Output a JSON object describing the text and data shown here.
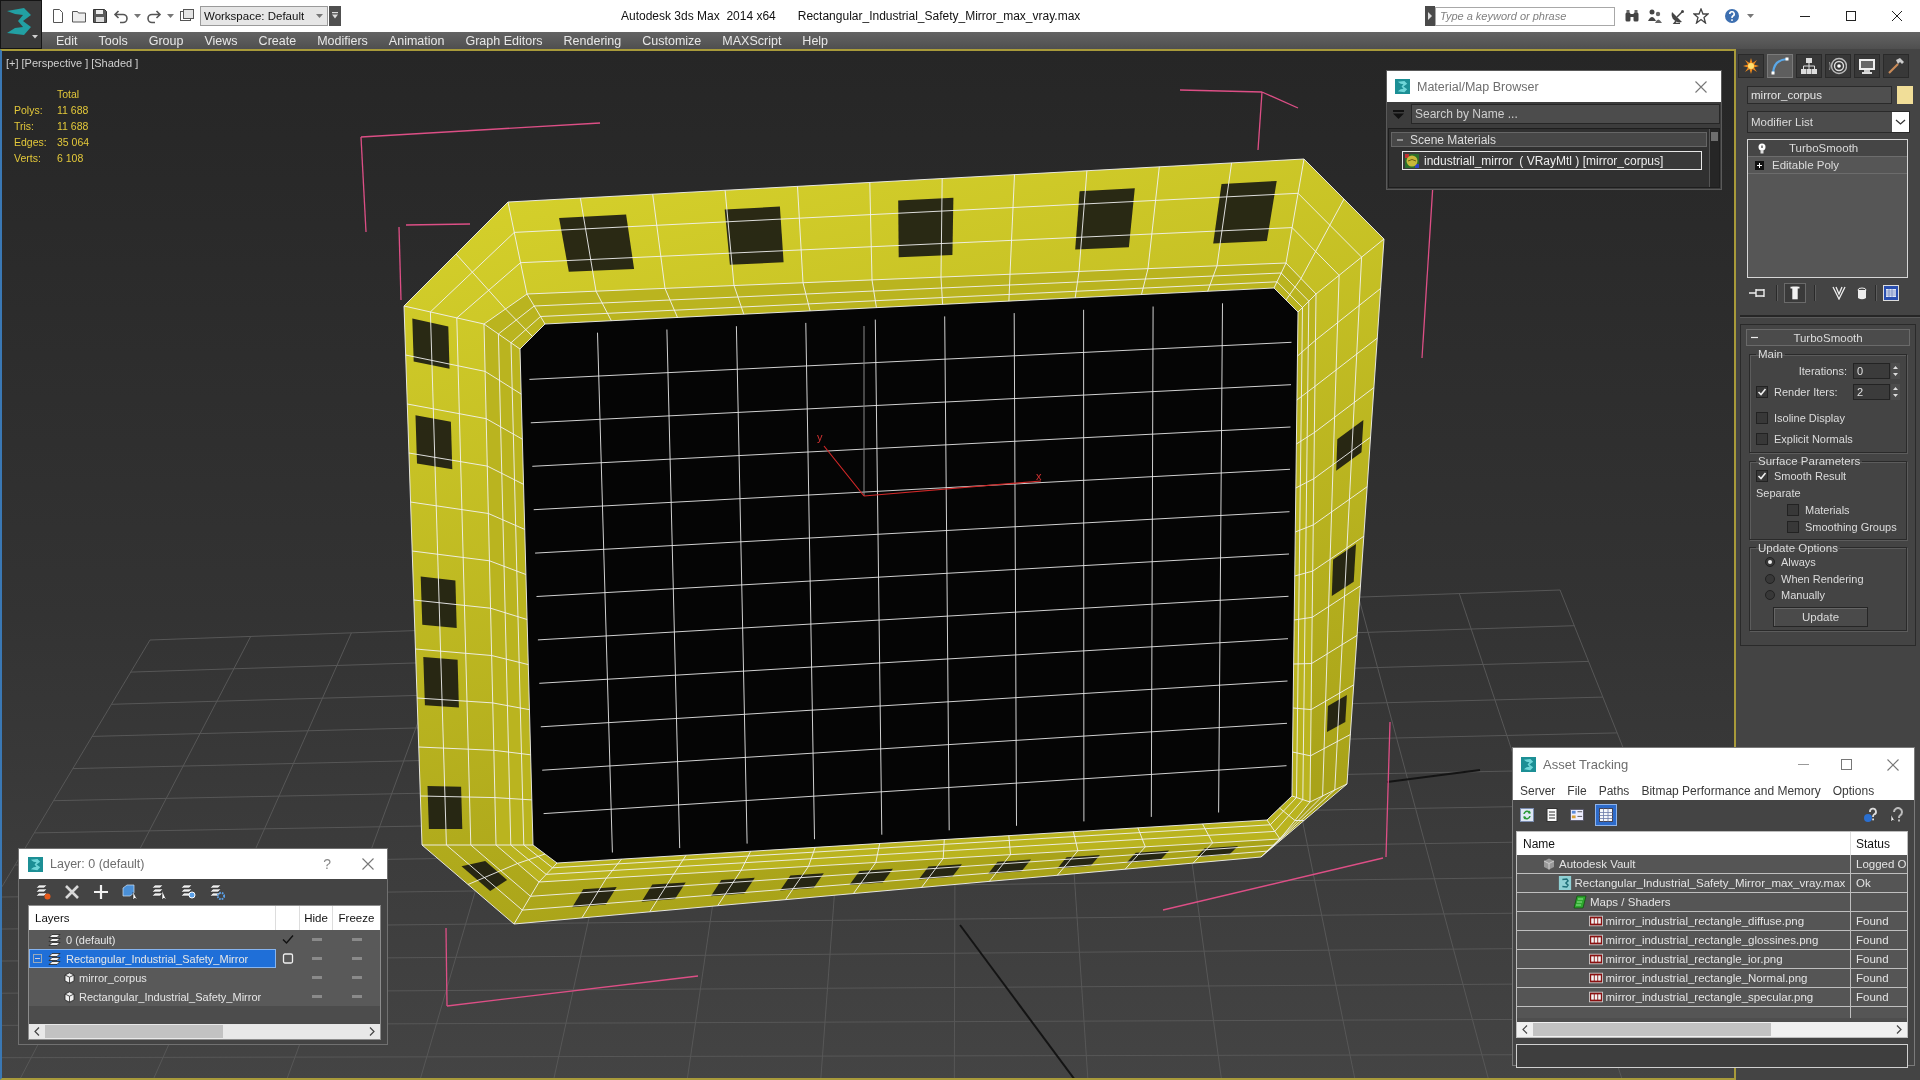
{
  "title_bar": {
    "workspace": "Workspace: Default",
    "app_title": "Autodesk 3ds Max  2014 x64",
    "file_name": "Rectangular_Industrial_Safety_Mirror_max_vray.max",
    "search": {
      "placeholder": "Type a keyword or phrase"
    }
  },
  "menu_bar": [
    "Edit",
    "Tools",
    "Group",
    "Views",
    "Create",
    "Modifiers",
    "Animation",
    "Graph Editors",
    "Rendering",
    "Customize",
    "MAXScript",
    "Help"
  ],
  "viewport": {
    "labels": [
      "[+]",
      "[Perspective ]",
      "[Shaded ]"
    ],
    "stats": {
      "header": "Total",
      "rows": [
        {
          "label": "Polys:",
          "value": "11 688"
        },
        {
          "label": "Tris:",
          "value": "11 688"
        },
        {
          "label": "Edges:",
          "value": "35 064"
        },
        {
          "label": "Verts:",
          "value": "6 108"
        }
      ]
    },
    "axis_labels": {
      "y": "y",
      "x": "x"
    }
  },
  "material_browser": {
    "title": "Material/Map Browser",
    "search": {
      "placeholder": "Search by Name ..."
    },
    "groups": [
      {
        "label": "Scene Materials",
        "expanded": true,
        "items": [
          {
            "label": "industriall_mirror  ( VRayMtl ) [mirror_corpus]",
            "selected": true
          }
        ]
      }
    ]
  },
  "command_panel": {
    "tabs": [
      {
        "kind": "create",
        "selected": false
      },
      {
        "kind": "modify",
        "selected": true
      },
      {
        "kind": "hierarchy",
        "selected": false
      },
      {
        "kind": "motion",
        "selected": false
      },
      {
        "kind": "display",
        "selected": false
      },
      {
        "kind": "utilities",
        "selected": false
      }
    ],
    "object_name": "mirror_corpus",
    "modifier_list": "Modifier List",
    "stack": [
      {
        "kind": "modifier",
        "label": "TurboSmooth",
        "selected": true
      },
      {
        "kind": "base",
        "label": "Editable Poly",
        "selected": false
      }
    ],
    "stack_tools": [
      {
        "kind": "pin",
        "on": false
      },
      {
        "kind": "end_result",
        "on": true
      },
      {
        "kind": "make_unique",
        "on": false
      },
      {
        "kind": "remove",
        "on": false
      },
      {
        "kind": "configure",
        "on": false
      }
    ],
    "rollout": {
      "title": "TurboSmooth",
      "expanded": true,
      "groups": [
        {
          "title": "Main",
          "items": [
            {
              "kind": "spinner",
              "label": "Iterations:",
              "value": "0"
            },
            {
              "kind": "check_spinner",
              "label": "Render Iters:",
              "checked": true,
              "value": "2"
            },
            {
              "kind": "checkbox",
              "label": "Isoline Display",
              "checked": false
            },
            {
              "kind": "checkbox",
              "label": "Explicit Normals",
              "checked": false
            }
          ]
        },
        {
          "title": "Surface Parameters",
          "items": [
            {
              "kind": "checkbox",
              "label": "Smooth Result",
              "checked": true
            },
            {
              "kind": "label",
              "label": "Separate"
            },
            {
              "kind": "sub_checkbox",
              "label": "Materials",
              "checked": false
            },
            {
              "kind": "sub_checkbox",
              "label": "Smoothing Groups",
              "checked": false
            }
          ]
        },
        {
          "title": "Update Options",
          "items": [
            {
              "kind": "radio",
              "label": "Always",
              "selected": true
            },
            {
              "kind": "radio",
              "label": "When Rendering",
              "selected": false
            },
            {
              "kind": "radio",
              "label": "Manually",
              "selected": false
            }
          ],
          "button": "Update"
        }
      ]
    }
  },
  "layer_manager": {
    "title": "Layer: 0 (default)",
    "help": "?",
    "columns": [
      "Layers",
      "Hide",
      "Freeze"
    ],
    "layers": [
      {
        "name": "0 (default)",
        "current": true,
        "selected": false,
        "hidden": false,
        "frozen": false
      },
      {
        "name": "Rectangular_Industrial_Safety_Mirror",
        "current": false,
        "selected": true,
        "hidden": false,
        "frozen": false,
        "expanded": true,
        "children": [
          {
            "name": "mirror_corpus",
            "selected": false,
            "hidden": false,
            "frozen": false
          },
          {
            "name": "Rectangular_Industrial_Safety_Mirror",
            "selected": false,
            "hidden": false,
            "frozen": false
          }
        ]
      }
    ]
  },
  "asset_tracking": {
    "title": "Asset Tracking",
    "menu": [
      "Server",
      "File",
      "Paths",
      "Bitmap Performance and Memory",
      "Options"
    ],
    "toolbar": [
      {
        "kind": "refresh",
        "on": false
      },
      {
        "kind": "list",
        "on": false
      },
      {
        "kind": "thumbnails",
        "on": false
      },
      {
        "kind": "table",
        "on": true
      }
    ],
    "columns": [
      "Name",
      "Status"
    ],
    "assets": [
      {
        "kind": "vault",
        "name": "Autodesk Vault",
        "status": "Logged O",
        "children": [
          {
            "kind": "max_file",
            "name": "Rectangular_Industrial_Safety_Mirror_max_vray.max",
            "status": "Ok",
            "children": [
              {
                "kind": "folder",
                "name": "Maps / Shaders",
                "children": [
                  {
                    "kind": "png",
                    "name": "mirror_industrial_rectangle_diffuse.png",
                    "status": "Found"
                  },
                  {
                    "kind": "png",
                    "name": "mirror_industrial_rectangle_glossines.png",
                    "status": "Found"
                  },
                  {
                    "kind": "png",
                    "name": "mirror_industrial_rectangle_ior.png",
                    "status": "Found"
                  },
                  {
                    "kind": "png",
                    "name": "mirror_industrial_rectangle_Normal.png",
                    "status": "Found"
                  },
                  {
                    "kind": "png",
                    "name": "mirror_industrial_rectangle_specular.png",
                    "status": "Found"
                  }
                ]
              }
            ]
          }
        ]
      }
    ]
  }
}
